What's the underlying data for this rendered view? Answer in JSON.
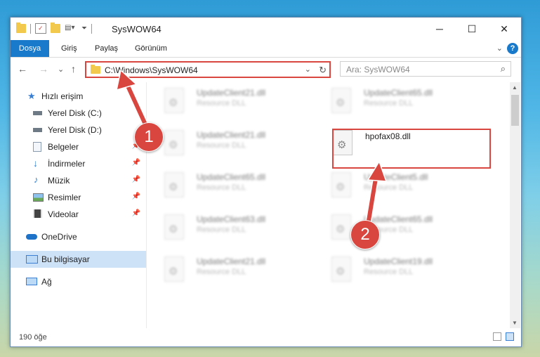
{
  "window": {
    "title": "SysWOW64",
    "minimize": "─",
    "maximize": "☐",
    "close": "✕"
  },
  "ribbon": {
    "tabs": [
      "Dosya",
      "Giriş",
      "Paylaş",
      "Görünüm"
    ],
    "help": "?",
    "expand": "⌄"
  },
  "nav": {
    "back": "←",
    "forward": "→",
    "recent": "⌄",
    "up": "↑",
    "path": "C:\\Windows\\SysWOW64",
    "search_placeholder": "Ara: SysWOW64"
  },
  "sidebar": {
    "items": [
      {
        "label": "Hızlı erişim",
        "icon": "star-icon",
        "color": "#3a7fd3"
      },
      {
        "label": "Yerel Disk (C:)",
        "icon": "drive-icon",
        "color": "#6e7a86"
      },
      {
        "label": "Yerel Disk (D:)",
        "icon": "drive-icon",
        "color": "#6e7a86"
      },
      {
        "label": "Belgeler",
        "icon": "documents-icon",
        "color": "#8a9bb0",
        "pinned": true
      },
      {
        "label": "İndirmeler",
        "icon": "download-icon",
        "color": "#2f7fd6",
        "pinned": true
      },
      {
        "label": "Müzik",
        "icon": "music-icon",
        "color": "#2f7fd6",
        "pinned": true
      },
      {
        "label": "Resimler",
        "icon": "pictures-icon",
        "color": "#4a9ad6",
        "pinned": true
      },
      {
        "label": "Videolar",
        "icon": "videos-icon",
        "color": "#444",
        "pinned": true
      },
      {
        "label": "OneDrive",
        "icon": "onedrive-icon",
        "color": "#1e73c8"
      },
      {
        "label": "Bu bilgisayar",
        "icon": "computer-icon",
        "color": "#3a7fd3",
        "selected": true
      },
      {
        "label": "Ağ",
        "icon": "network-icon",
        "color": "#3a7fd3"
      }
    ]
  },
  "files": [
    {
      "name": "UpdateClient21.dll",
      "desc": "Resource DLL"
    },
    {
      "name": "UpdateClient65.dll",
      "desc": "Resource DLL"
    },
    {
      "name": "UpdateClient21.dll",
      "desc": "Resource DLL"
    },
    {
      "name": "hpofax08.dll",
      "desc": ""
    },
    {
      "name": "UpdateClient65.dll",
      "desc": "Resource DLL"
    },
    {
      "name": "UpdateClient5.dll",
      "desc": "Resource DLL"
    },
    {
      "name": "UpdateClient63.dll",
      "desc": "Resource DLL"
    },
    {
      "name": "UpdateClient65.dll",
      "desc": "Resource DLL"
    },
    {
      "name": "UpdateClient21.dll",
      "desc": "Resource DLL"
    },
    {
      "name": "UpdateClient19.dll",
      "desc": "Resource DLL"
    }
  ],
  "status": {
    "count": "190 öğe"
  },
  "annotations": {
    "step1": "1",
    "step2": "2",
    "color": "#d8463f"
  }
}
